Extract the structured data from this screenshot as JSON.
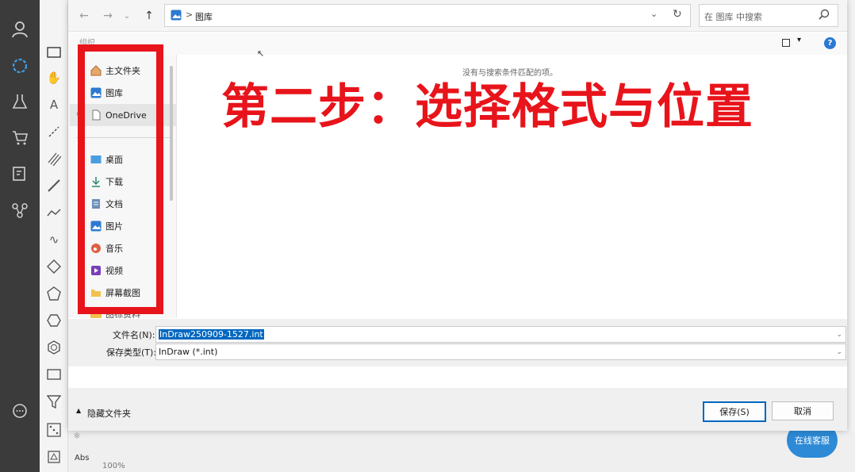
{
  "dialog": {
    "address": {
      "breadcrumb": "图库",
      "sep": ">"
    },
    "search_placeholder": "在 图库 中搜索",
    "toolbar_label": "组织",
    "nav_pane": [
      {
        "label": "主文件夹",
        "icon": "home-icon"
      },
      {
        "label": "图库",
        "icon": "gallery-icon"
      },
      {
        "label": "OneDrive",
        "icon": "file-icon"
      },
      {
        "label": "桌面",
        "icon": "desktop-icon"
      },
      {
        "label": "下载",
        "icon": "download-icon"
      },
      {
        "label": "文档",
        "icon": "document-icon"
      },
      {
        "label": "图片",
        "icon": "pictures-icon"
      },
      {
        "label": "音乐",
        "icon": "music-icon"
      },
      {
        "label": "视频",
        "icon": "video-icon"
      },
      {
        "label": "屏幕截图",
        "icon": "folder-icon"
      }
    ],
    "partial_item": "图标资料",
    "empty_message": "没有与搜索条件匹配的项。",
    "filename_label": "文件名(N):",
    "filename_value": "InDraw250909-1527.int",
    "filetype_label": "保存类型(T):",
    "filetype_value": "InDraw (*.int)",
    "hide_folders": "隐藏文件夹",
    "save_label": "保存(S)",
    "cancel_label": "取消"
  },
  "overlay": {
    "headline": "第二步：选择格式与位置"
  },
  "app": {
    "zoom": "100%",
    "abs_label": "Abs",
    "support_badge": "在线客服"
  },
  "colors": {
    "annotation_red": "#e8141b",
    "rail": "#3b3b3b",
    "accent": "#0067c0"
  }
}
